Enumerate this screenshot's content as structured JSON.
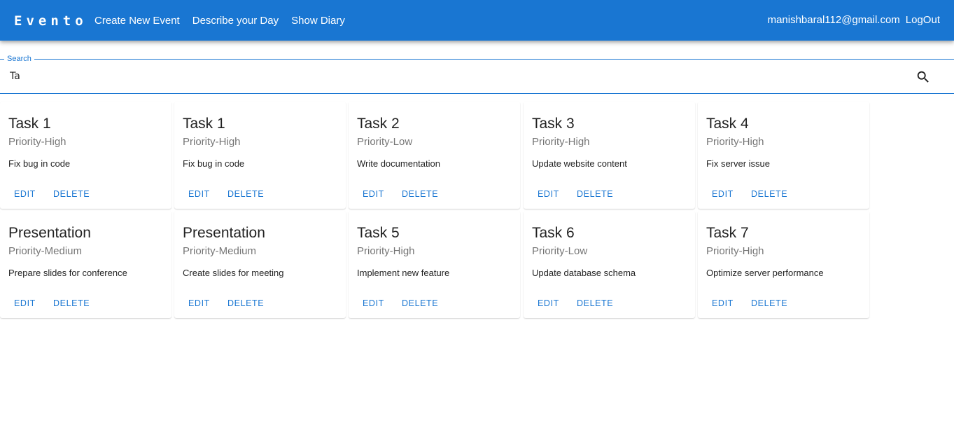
{
  "header": {
    "brand": "Evento",
    "nav": [
      "Create New Event",
      "Describe your Day",
      "Show Diary"
    ],
    "user_email": "manishbaral112@gmail.com",
    "logout_label": "LogOut"
  },
  "search": {
    "label": "Search",
    "value": "Ta"
  },
  "cards": [
    {
      "title": "Task 1",
      "priority": "Priority-High",
      "description": "Fix bug in code",
      "edit_label": "EDIT",
      "delete_label": "DELETE"
    },
    {
      "title": "Task 1",
      "priority": "Priority-High",
      "description": "Fix bug in code",
      "edit_label": "EDIT",
      "delete_label": "DELETE"
    },
    {
      "title": "Task 2",
      "priority": "Priority-Low",
      "description": "Write documentation",
      "edit_label": "EDIT",
      "delete_label": "DELETE"
    },
    {
      "title": "Task 3",
      "priority": "Priority-High",
      "description": "Update website content",
      "edit_label": "EDIT",
      "delete_label": "DELETE"
    },
    {
      "title": "Task 4",
      "priority": "Priority-High",
      "description": "Fix server issue",
      "edit_label": "EDIT",
      "delete_label": "DELETE"
    },
    {
      "title": "Presentation",
      "priority": "Priority-Medium",
      "description": "Prepare slides for conference",
      "edit_label": "EDIT",
      "delete_label": "DELETE"
    },
    {
      "title": "Presentation",
      "priority": "Priority-Medium",
      "description": "Create slides for meeting",
      "edit_label": "EDIT",
      "delete_label": "DELETE"
    },
    {
      "title": "Task 5",
      "priority": "Priority-High",
      "description": "Implement new feature",
      "edit_label": "EDIT",
      "delete_label": "DELETE"
    },
    {
      "title": "Task 6",
      "priority": "Priority-Low",
      "description": "Update database schema",
      "edit_label": "EDIT",
      "delete_label": "DELETE"
    },
    {
      "title": "Task 7",
      "priority": "Priority-High",
      "description": "Optimize server performance",
      "edit_label": "EDIT",
      "delete_label": "DELETE"
    }
  ],
  "colors": {
    "primary": "#1976d2",
    "secondary_text": "#757575"
  }
}
